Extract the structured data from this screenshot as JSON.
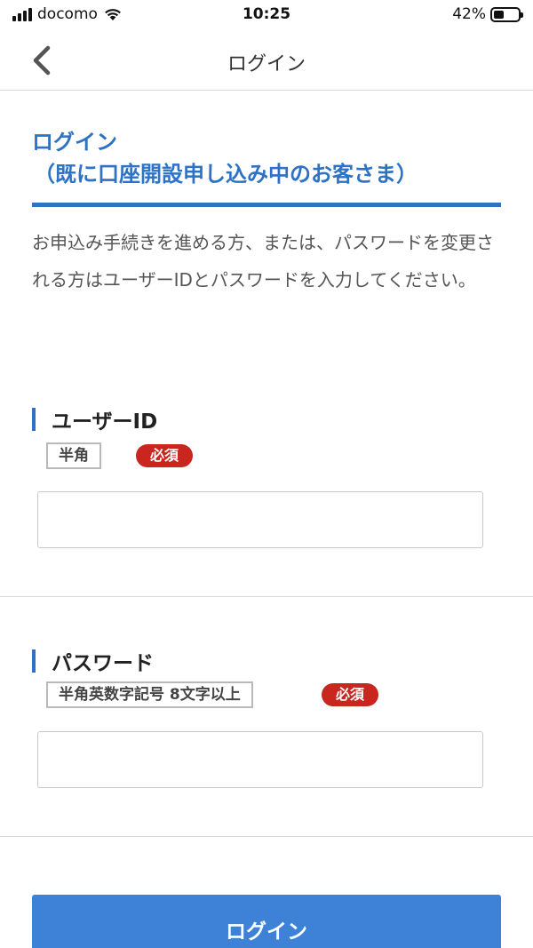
{
  "status_bar": {
    "carrier": "docomo",
    "time": "10:25",
    "battery_percent_text": "42%",
    "battery_level": 0.42
  },
  "nav": {
    "title": "ログイン",
    "back_icon": "chevron-left-icon"
  },
  "heading": {
    "line1": "ログイン",
    "line2": "（既に口座開設申し込み中のお客さま）"
  },
  "description": "お申込み手続きを進める方、または、パスワードを変更される方はユーザーIDとパスワードを入力してください。",
  "user_id_field": {
    "label": "ユーザーID",
    "format_tag": "半角",
    "required_tag": "必須",
    "value": ""
  },
  "password_field": {
    "label": "パスワード",
    "format_tag": "半角英数字記号 8文字以上",
    "required_tag": "必須",
    "value": ""
  },
  "login_button": {
    "label": "ログイン"
  },
  "colors": {
    "accent": "#2d72c4",
    "button": "#3d82d6",
    "required": "#c8261f"
  }
}
